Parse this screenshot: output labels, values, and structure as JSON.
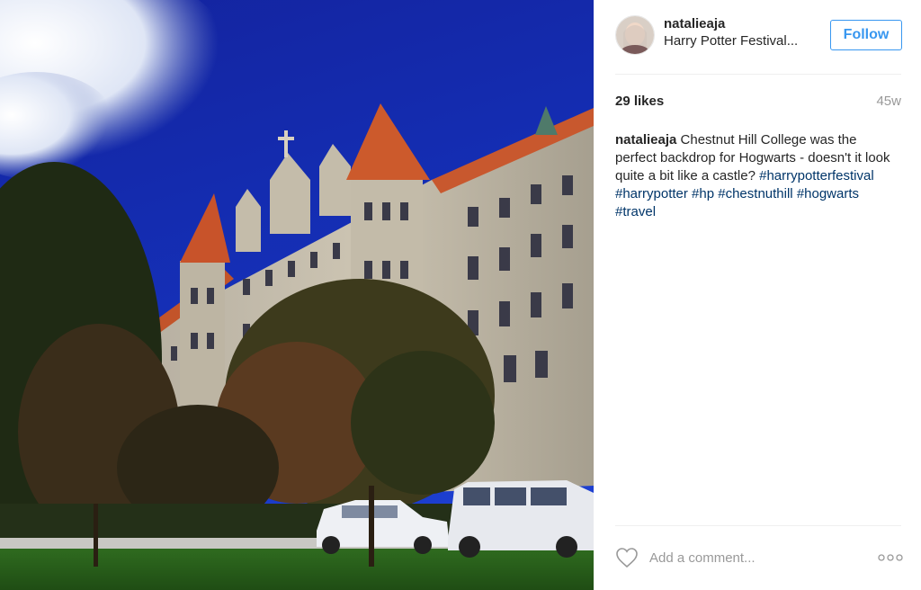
{
  "photo": {
    "description_icon": "photo-icon"
  },
  "header": {
    "username": "natalieaja",
    "location": "Harry Potter Festival...",
    "follow_label": "Follow",
    "accent_color": "#3897f0"
  },
  "stats": {
    "likes": "29 likes",
    "timestamp": "45w"
  },
  "caption": {
    "username": "natalieaja",
    "text": " Chestnut Hill College was the perfect backdrop for Hogwarts - doesn't it look quite a bit like a castle?",
    "hashtags": [
      "#harrypotterfestival",
      "#harrypotter",
      "#hp",
      "#chestnuthill",
      "#hogwarts",
      "#travel"
    ],
    "hashtag_color": "#003569"
  },
  "comment": {
    "placeholder": "Add a comment...",
    "like_icon": "heart-icon",
    "more_icon": "more-options-icon"
  }
}
